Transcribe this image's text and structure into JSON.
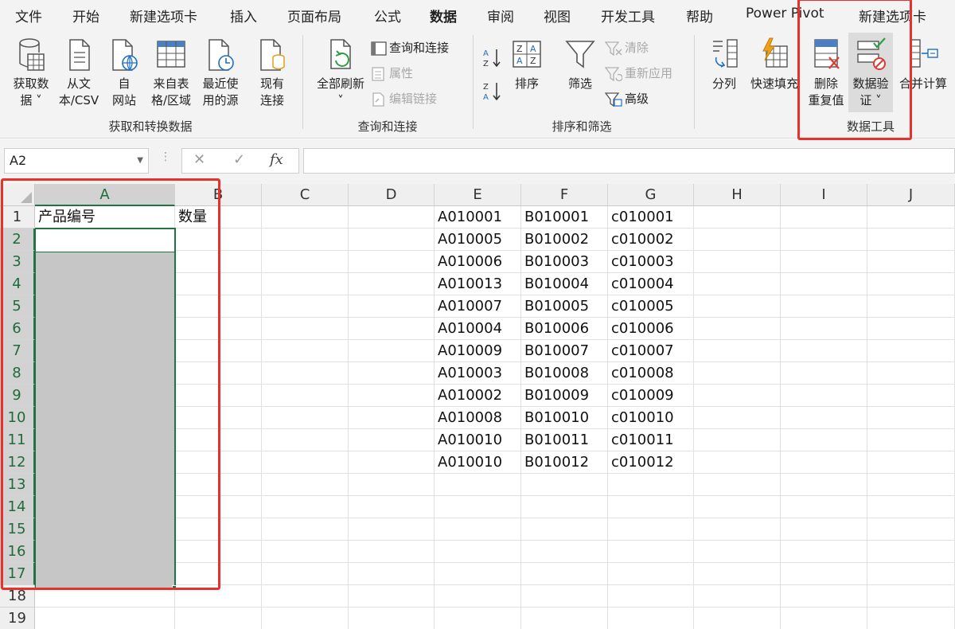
{
  "menu_tabs": [
    "文件",
    "开始",
    "新建选项卡",
    "插入",
    "页面布局",
    "公式",
    "数据",
    "审阅",
    "视图",
    "开发工具",
    "帮助",
    "Power Pivot",
    "新建选项卡"
  ],
  "active_tab": "数据",
  "ribbon": {
    "get_transform": {
      "group_label": "获取和转换数据",
      "get_data": "获取数\n据 ˅",
      "from_csv": "从文\n本/CSV",
      "from_web": "自\n网站",
      "from_table": "来自表\n格/区域",
      "recent_sources": "最近使\n用的源",
      "existing_connections": "现有\n连接"
    },
    "queries_connections": {
      "group_label": "查询和连接",
      "refresh_all": "全部刷新\n˅",
      "queries_and_connections": "查询和连接",
      "properties": "属性",
      "edit_links": "编辑链接"
    },
    "sort_filter": {
      "group_label": "排序和筛选",
      "sort": "排序",
      "filter": "筛选",
      "clear": "清除",
      "reapply": "重新应用",
      "advanced": "高级"
    },
    "data_tools": {
      "group_label": "数据工具",
      "text_to_columns": "分列",
      "flash_fill": "快速填充",
      "remove_duplicates": "删除\n重复值",
      "data_validation": "数据验\n证 ˅",
      "consolidate": "合并计算"
    }
  },
  "formula_bar": {
    "name_box": "A2",
    "cancel_glyph": "✕",
    "enter_glyph": "✓",
    "fx_label": "fx",
    "formula": ""
  },
  "columns": [
    "A",
    "B",
    "C",
    "D",
    "E",
    "F",
    "G",
    "H",
    "I",
    "J"
  ],
  "selected_column": "A",
  "rows": [
    "1",
    "2",
    "3",
    "4",
    "5",
    "6",
    "7",
    "8",
    "9",
    "10",
    "11",
    "12",
    "13",
    "14",
    "15",
    "16",
    "17",
    "18",
    "19"
  ],
  "selected_rows": [
    "2",
    "3",
    "4",
    "5",
    "6",
    "7",
    "8",
    "9",
    "10",
    "11",
    "12",
    "13",
    "14",
    "15",
    "16",
    "17"
  ],
  "cells": {
    "A1": "产品编号",
    "B1": "数量",
    "E": [
      "A010001",
      "A010005",
      "A010006",
      "A010013",
      "A010007",
      "A010004",
      "A010009",
      "A010003",
      "A010002",
      "A010008",
      "A010010",
      "A010010"
    ],
    "F": [
      "B010001",
      "B010002",
      "B010003",
      "B010004",
      "B010005",
      "B010006",
      "B010007",
      "B010008",
      "B010009",
      "B010010",
      "B010011",
      "B010012"
    ],
    "G": [
      "c010001",
      "c010002",
      "c010003",
      "c010004",
      "c010005",
      "c010006",
      "c010007",
      "c010008",
      "c010009",
      "c010010",
      "c010011",
      "c010012"
    ]
  },
  "colors": {
    "accent_green": "#217346",
    "annotation_red": "#e8312a",
    "ribbon_bg": "#f3f3f3",
    "selection_fill": "#c6c6c6"
  },
  "icons": [
    "get-data-icon",
    "from-csv-icon",
    "from-web-icon",
    "from-table-icon",
    "recent-sources-icon",
    "existing-connections-icon",
    "refresh-all-icon",
    "queries-connections-icon",
    "properties-icon",
    "edit-links-icon",
    "sort-az-icon",
    "sort-za-icon",
    "sort-icon",
    "filter-icon",
    "clear-icon",
    "reapply-icon",
    "advanced-filter-icon",
    "text-to-columns-icon",
    "flash-fill-icon",
    "remove-duplicates-icon",
    "data-validation-icon",
    "consolidate-icon"
  ]
}
